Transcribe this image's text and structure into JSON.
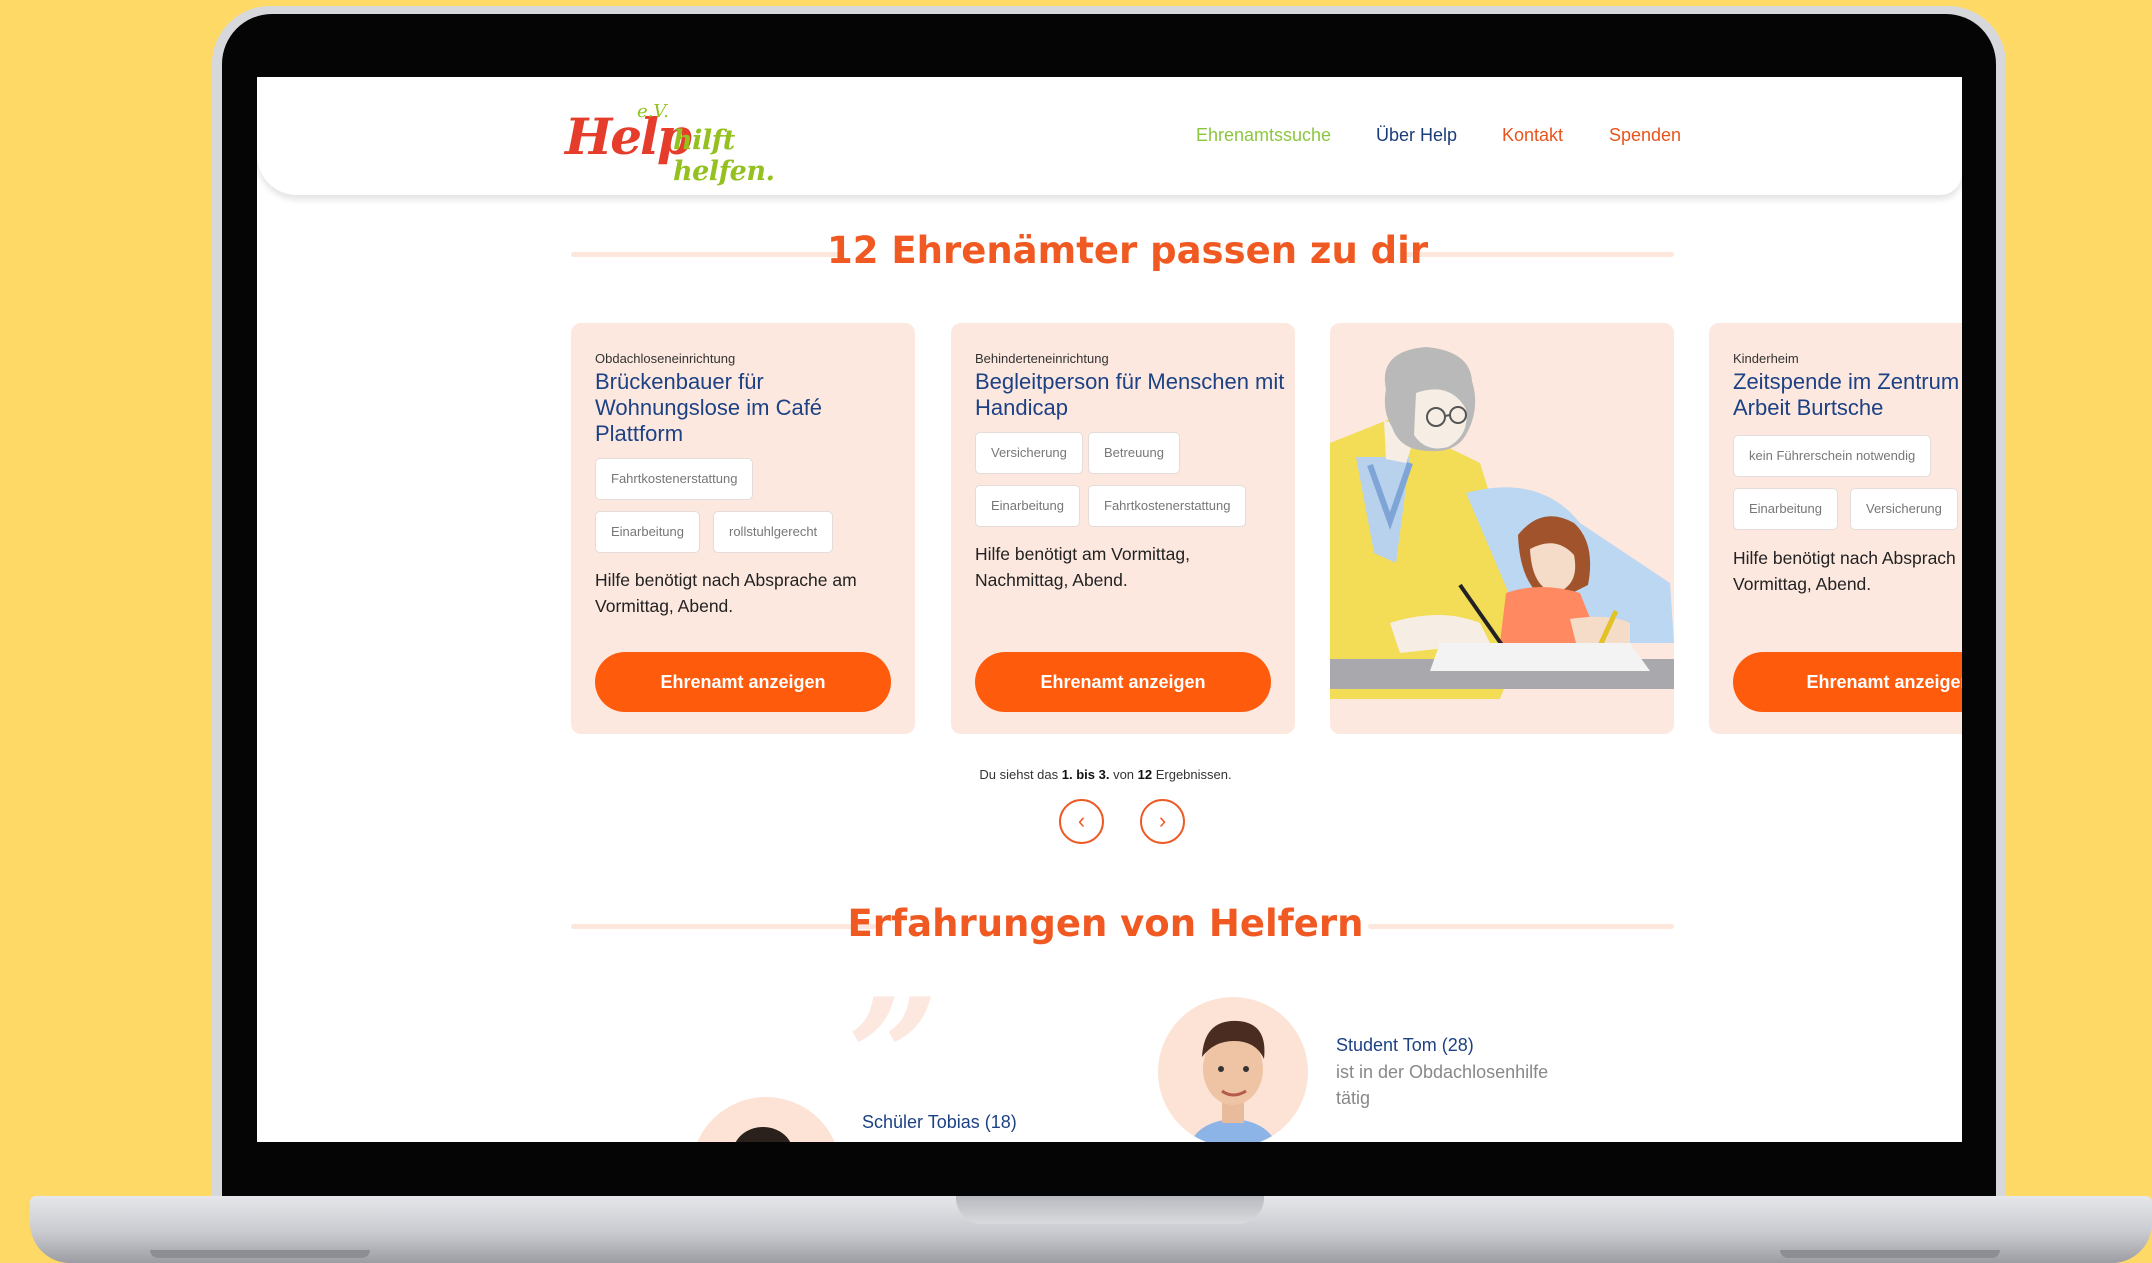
{
  "header": {
    "logo_main": "Help",
    "logo_ev": "e.V.",
    "logo_claim": "hilft helfen.",
    "nav": [
      "Ehrenamtssuche",
      "Über Help",
      "Kontakt",
      "Spenden"
    ]
  },
  "results_section": {
    "title": "12 Ehrenämter passen zu dir",
    "cards": [
      {
        "category": "Obdachloseneinrichtung",
        "title": "Brückenbauer für Wohnungslose im Café Plattform",
        "tags": [
          "Fahrtkostenerstattung",
          "Einarbeitung",
          "rollstuhlgerecht"
        ],
        "text": "Hilfe benötigt nach Absprache am Vormittag, Abend.",
        "button": "Ehrenamt anzeigen"
      },
      {
        "category": "Behinderteneinrichtung",
        "title": "Begleitperson für Menschen mit Handicap",
        "tags": [
          "Versicherung",
          "Betreuung",
          "Einarbeitung",
          "Fahrtkostenerstattung"
        ],
        "text": "Hilfe benötigt  am Vormittag, Nachmittag, Abend.",
        "button": "Ehrenamt anzeigen"
      },
      {
        "category": "Kinderheim",
        "title": "Zeitspende im Zentrum soziale Arbeit Burtsche",
        "tags": [
          "kein Führerschein notwendig",
          "Einarbeitung",
          "Versicherung"
        ],
        "text": "Hilfe benötigt nach Absprach Vormittag, Abend.",
        "button": "Ehrenamt anzeigen"
      }
    ],
    "result_info": {
      "prefix": "Du siehst das ",
      "range": "1. bis 3.",
      "middle": " von ",
      "total": "12",
      "suffix": " Ergebnissen."
    },
    "pager": {
      "prev": "‹",
      "next": "›"
    }
  },
  "testimonials_section": {
    "title": "Erfahrungen von Helfern",
    "quote_mark": "”",
    "items": [
      {
        "name": "Schüler Tobias (18)",
        "desc": ""
      },
      {
        "name": "Student Tom (28)",
        "desc": "ist in der Obdachlosenhilfe tätig"
      }
    ]
  },
  "colors": {
    "background": "#ffd965",
    "accent_orange": "#ff5b0d",
    "title_orange": "#f05a22",
    "navy": "#1c4184",
    "green": "#8cc63f",
    "card_bg": "#fde8e0"
  }
}
